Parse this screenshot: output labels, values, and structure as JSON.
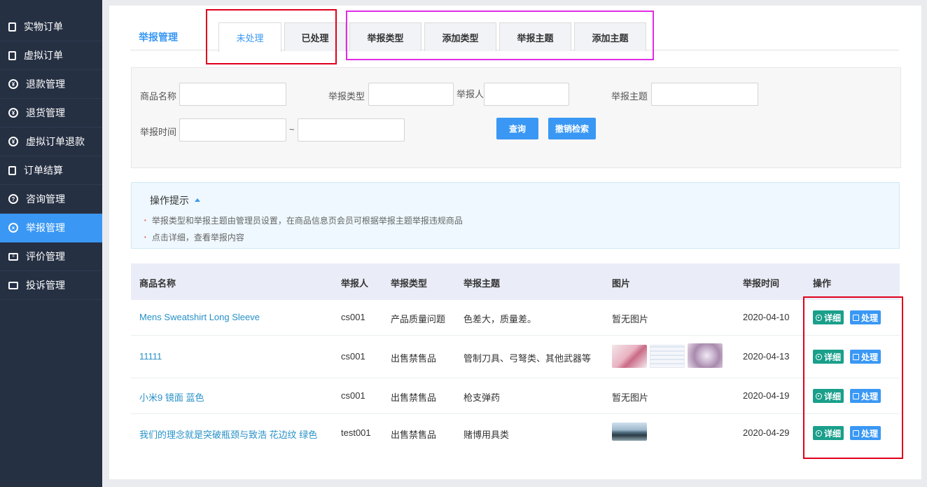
{
  "sidebar": {
    "items": [
      {
        "label": "实物订单",
        "icon": "document-icon"
      },
      {
        "label": "虚拟订单",
        "icon": "document-icon"
      },
      {
        "label": "退款管理",
        "icon": "refund-icon"
      },
      {
        "label": "退货管理",
        "icon": "refund-icon"
      },
      {
        "label": "虚拟订单退款",
        "icon": "refund-icon"
      },
      {
        "label": "订单结算",
        "icon": "document-icon"
      },
      {
        "label": "咨询管理",
        "icon": "question-icon"
      },
      {
        "label": "举报管理",
        "icon": "close-circle-icon",
        "active": true
      },
      {
        "label": "评价管理",
        "icon": "comment-icon"
      },
      {
        "label": "投诉管理",
        "icon": "store-icon"
      }
    ]
  },
  "header": {
    "title": "举报管理",
    "tabs": [
      "未处理",
      "已处理",
      "举报类型",
      "添加类型",
      "举报主题",
      "添加主题"
    ]
  },
  "search": {
    "goods_name_label": "商品名称",
    "type_label": "举报类型",
    "reporter_label": "举报人",
    "subject_label": "举报主题",
    "time_label": "举报时间",
    "range_sep": "~",
    "query_button": "查询",
    "reset_button": "撤销检索"
  },
  "tips": {
    "title": "操作提示",
    "lines": [
      "举报类型和举报主题由管理员设置，在商品信息页会员可根据举报主题举报违规商品",
      "点击详细，查看举报内容"
    ]
  },
  "table": {
    "headers": [
      "商品名称",
      "举报人",
      "举报类型",
      "举报主题",
      "图片",
      "举报时间",
      "操作"
    ],
    "rows": [
      {
        "name": "Mens Sweatshirt Long Sleeve",
        "reporter": "cs001",
        "type": "产品质量问题",
        "subject": "色差大，质量差。",
        "image_text": "暂无图片",
        "images": [],
        "time": "2020-04-10"
      },
      {
        "name": "11111",
        "reporter": "cs001",
        "type": "出售禁售品",
        "subject": "管制刀具、弓弩类、其他武器等",
        "image_text": "",
        "images": [
          "flower-photo",
          "screenshot-photo",
          "flowers-plate-photo"
        ],
        "time": "2020-04-13"
      },
      {
        "name": "小米9 镜面 蓝色",
        "reporter": "cs001",
        "type": "出售禁售品",
        "subject": "枪支弹药",
        "image_text": "暂无图片",
        "images": [],
        "time": "2020-04-19"
      },
      {
        "name": "我们的理念就是突破瓶颈与致浩 花边纹 绿色",
        "reporter": "test001",
        "type": "出售禁售品",
        "subject": "赌博用具类",
        "image_text": "",
        "images": [
          "town-photo"
        ],
        "time": "2020-04-29"
      }
    ],
    "detail_label": "详细",
    "handle_label": "处理"
  },
  "colors": {
    "sidebar_bg": "#263043",
    "accent": "#3a98f4",
    "green": "#1a9f8b",
    "annotation_red": "#e0001b",
    "annotation_pink": "#e02ce6"
  }
}
